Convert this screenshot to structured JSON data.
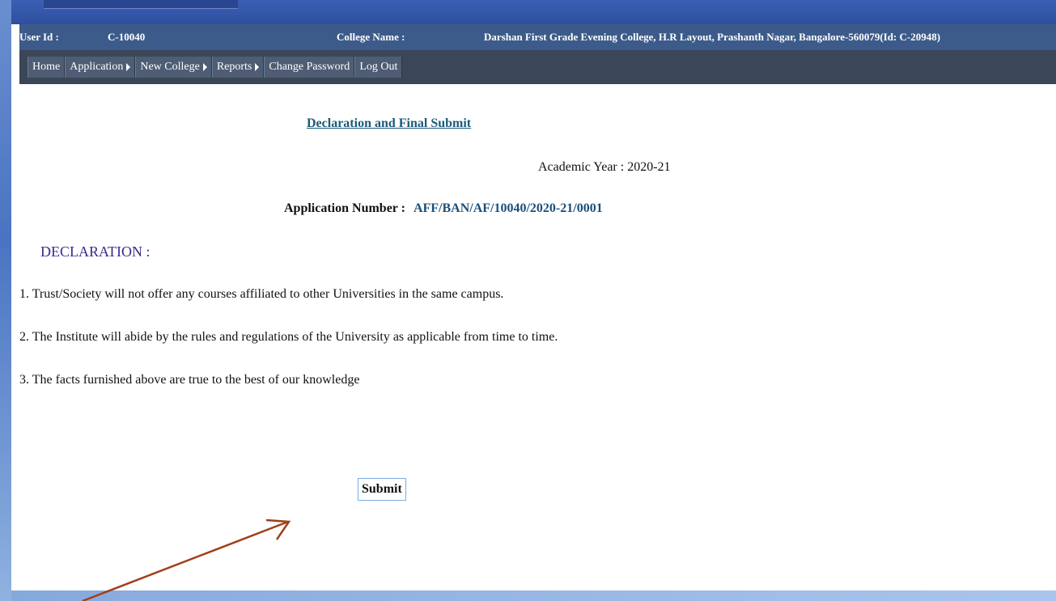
{
  "header": {
    "user_id_label": "User Id :",
    "user_id": "C-10040",
    "college_name_label": "College Name :",
    "college_name": "Darshan First Grade Evening College, H.R Layout, Prashanth Nagar, Bangalore-560079(Id: C-20948)"
  },
  "menu": {
    "items": [
      {
        "label": "Home",
        "has_submenu": false
      },
      {
        "label": "Application",
        "has_submenu": true
      },
      {
        "label": "New College",
        "has_submenu": true
      },
      {
        "label": "Reports",
        "has_submenu": true
      },
      {
        "label": "Change Password",
        "has_submenu": false
      },
      {
        "label": "Log Out",
        "has_submenu": false
      }
    ]
  },
  "main": {
    "title": "Declaration and Final Submit",
    "academic_year_label": "Academic Year :",
    "academic_year": "2020-21",
    "application_number_label": "Application Number :",
    "application_number": "AFF/BAN/AF/10040/2020-21/0001",
    "declaration_heading": "DECLARATION :",
    "declarations": [
      "1. Trust/Society will not offer any courses affiliated to other Universities in the same campus.",
      "2. The Institute will abide by the rules and regulations of the University as applicable from time to time.",
      "3. The facts furnished above are true to the best of our knowledge"
    ],
    "submit_label": "Submit"
  },
  "annotation": {
    "arrow_color": "#a0401a"
  },
  "colors": {
    "infobar": "#3c5b8a",
    "menubar": "#3b4658",
    "title": "#1a5a7a",
    "declaration_heading": "#3a2a8a"
  }
}
